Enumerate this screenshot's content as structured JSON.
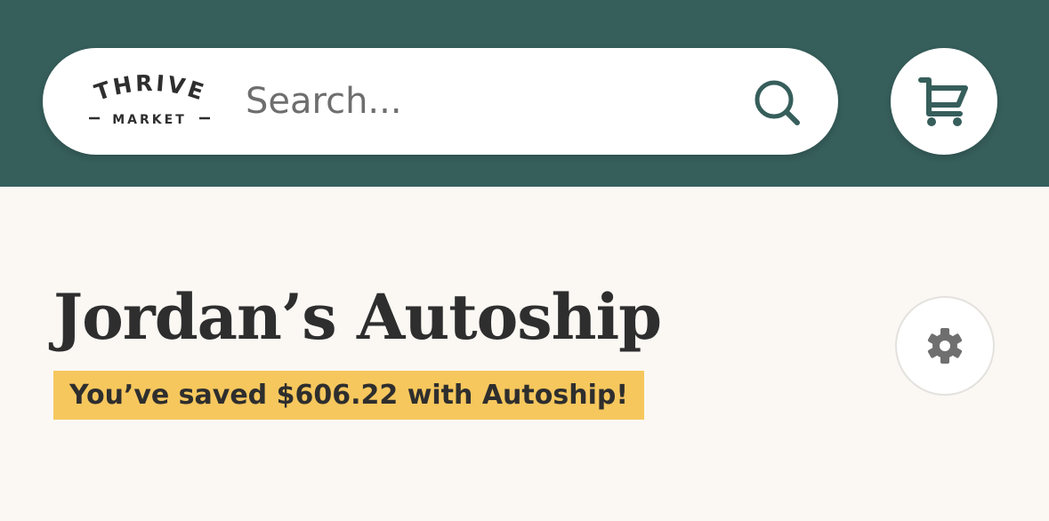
{
  "header": {
    "logo": {
      "line1": "THRIVE",
      "line2": "MARKET"
    },
    "search": {
      "placeholder": "Search...",
      "value": "",
      "icon": "search-icon"
    },
    "cart": {
      "icon": "cart-icon"
    },
    "colors": {
      "background": "#365e5b",
      "accent": "#365e5b"
    }
  },
  "main": {
    "title": "Jordan’s Autoship",
    "savings_text": "You’ve saved $606.22 with Autoship!",
    "settings": {
      "icon": "gear-icon"
    },
    "colors": {
      "background": "#fbf8f4",
      "badge": "#f6c75d"
    }
  }
}
